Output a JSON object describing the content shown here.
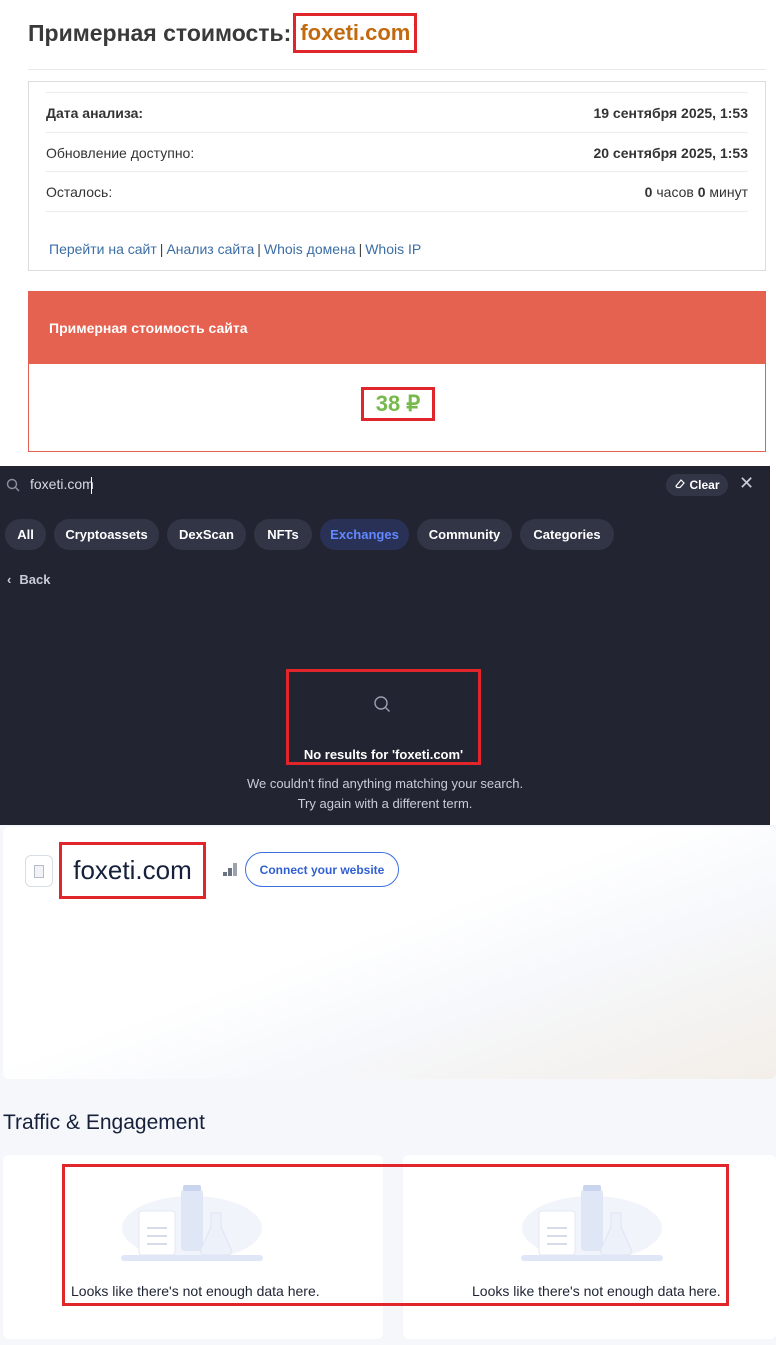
{
  "estimate": {
    "title_prefix": "Примерная стоимость:",
    "domain": "foxeti.com",
    "rows": [
      {
        "label": "Дата анализа:",
        "value": "19 сентября 2025, 1:53"
      },
      {
        "label": "Обновление доступно:",
        "value": "20 сентября 2025, 1:53"
      }
    ],
    "remaining": {
      "label": "Осталось:",
      "hours": "0",
      "hours_unit": "часов",
      "minutes": "0",
      "minutes_unit": "минут"
    },
    "links": [
      "Перейти на сайт",
      "Анализ сайта",
      "Whois домена",
      "Whois IP"
    ],
    "link_separator": "|",
    "cost_header": "Примерная стоимость сайта",
    "cost_value": "38 ₽"
  },
  "search": {
    "query": "foxeti.com",
    "clear_label": "Clear",
    "close_label": "✕",
    "tabs": [
      "All",
      "Cryptoassets",
      "DexScan",
      "NFTs",
      "Exchanges",
      "Community",
      "Categories"
    ],
    "active_tab": "Exchanges",
    "back_label": "Back",
    "no_results_title": "No results for 'foxeti.com'",
    "no_results_line1": "We couldn't find anything matching your search.",
    "no_results_line2": "Try again with a different term."
  },
  "site": {
    "name": "foxeti.com",
    "connect_label": "Connect your website",
    "section_title": "Traffic & Engagement",
    "empty_message": "Looks like there's not enough data here."
  },
  "colors": {
    "accent_red": "#e0252b",
    "cost_header_bg": "#e56150",
    "cost_value": "#78b94d",
    "domain_orange": "#c26a0f",
    "dark_bg": "#222531",
    "active_tab_text": "#6188ff"
  }
}
